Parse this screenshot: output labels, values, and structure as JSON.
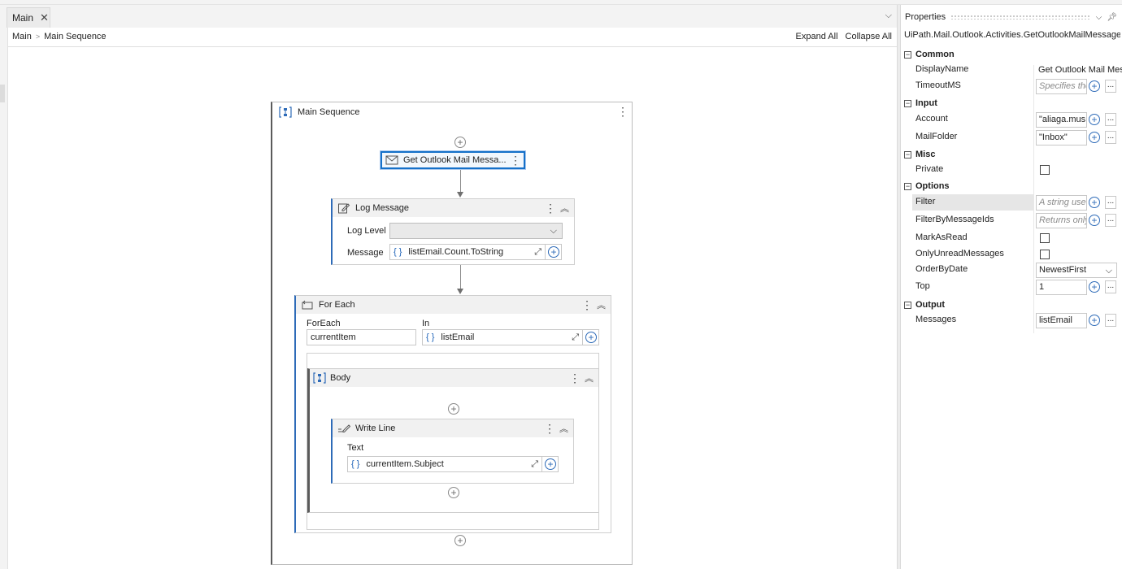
{
  "tab": {
    "title": "Main"
  },
  "breadcrumb": {
    "root": "Main",
    "current": "Main Sequence"
  },
  "toolbar": {
    "expand_all": "Expand All",
    "collapse_all": "Collapse All"
  },
  "workflow": {
    "sequence_title": "Main Sequence",
    "get_mail_title": "Get Outlook Mail Messa...",
    "log_message": {
      "title": "Log Message",
      "level_label": "Log Level",
      "level_value": "",
      "message_label": "Message",
      "message_value": "listEmail.Count.ToString"
    },
    "for_each": {
      "title": "For Each",
      "foreach_label": "ForEach",
      "item_value": "currentItem",
      "in_label": "In",
      "in_value": "listEmail"
    },
    "body": {
      "title": "Body"
    },
    "write_line": {
      "title": "Write Line",
      "text_label": "Text",
      "text_value": "currentItem.Subject"
    }
  },
  "properties": {
    "title": "Properties",
    "type_name": "UiPath.Mail.Outlook.Activities.GetOutlookMailMessages",
    "categories": {
      "common": "Common",
      "input": "Input",
      "misc": "Misc",
      "options": "Options",
      "output": "Output"
    },
    "rows": {
      "display_name": {
        "name": "DisplayName",
        "value": "Get Outlook Mail Messages"
      },
      "timeout": {
        "name": "TimeoutMS",
        "placeholder": "Specifies the amount of time"
      },
      "account": {
        "name": "Account",
        "value": "\"aliaga.mus"
      },
      "mail_folder": {
        "name": "MailFolder",
        "value": "\"Inbox\""
      },
      "private": {
        "name": "Private"
      },
      "filter": {
        "name": "Filter",
        "placeholder": "A string used as a filter"
      },
      "filter_ids": {
        "name": "FilterByMessageIds",
        "placeholder": "Returns only the messages"
      },
      "mark_as_read": {
        "name": "MarkAsRead"
      },
      "only_unread": {
        "name": "OnlyUnreadMessages"
      },
      "order_by": {
        "name": "OrderByDate",
        "value": "NewestFirst"
      },
      "top": {
        "name": "Top",
        "value": "1"
      },
      "messages": {
        "name": "Messages",
        "value": "listEmail"
      }
    }
  }
}
